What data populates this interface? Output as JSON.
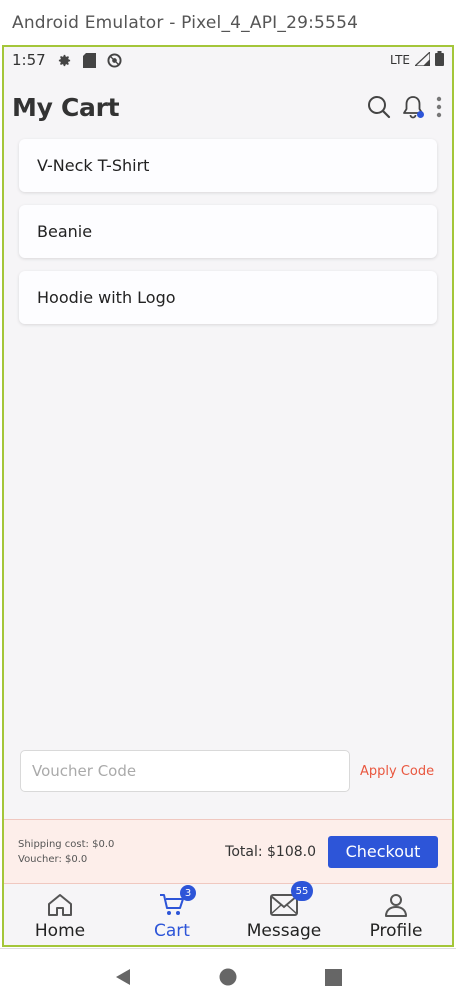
{
  "window": {
    "title": "Android Emulator - Pixel_4_API_29:5554"
  },
  "status_bar": {
    "time": "1:57",
    "network": "LTE",
    "icons": [
      "settings-icon",
      "sd-card-icon",
      "sync-icon",
      "signal-icon",
      "battery-icon"
    ]
  },
  "app_bar": {
    "title": "My Cart",
    "actions": [
      "search-icon",
      "bell-icon",
      "more-vert-icon"
    ]
  },
  "cart": {
    "items": [
      {
        "name": "V-Neck T-Shirt"
      },
      {
        "name": "Beanie"
      },
      {
        "name": "Hoodie with Logo"
      }
    ]
  },
  "voucher": {
    "placeholder": "Voucher Code",
    "value": "",
    "apply_label": "Apply Code"
  },
  "summary": {
    "shipping": "Shipping cost: $0.0",
    "voucher": "Voucher: $0.0",
    "total": "Total: $108.0",
    "checkout_label": "Checkout"
  },
  "bottom_nav": {
    "items": [
      {
        "label": "Home",
        "icon": "home-icon",
        "active": false,
        "badge": ""
      },
      {
        "label": "Cart",
        "icon": "cart-icon",
        "active": true,
        "badge": "3"
      },
      {
        "label": "Message",
        "icon": "mail-icon",
        "active": false,
        "badge": "55"
      },
      {
        "label": "Profile",
        "icon": "person-icon",
        "active": false,
        "badge": ""
      }
    ]
  },
  "colors": {
    "accent": "#2d55d8",
    "link": "#e9573f",
    "summary_bg": "#fdeeea",
    "emulator_frame": "#a4c639"
  }
}
